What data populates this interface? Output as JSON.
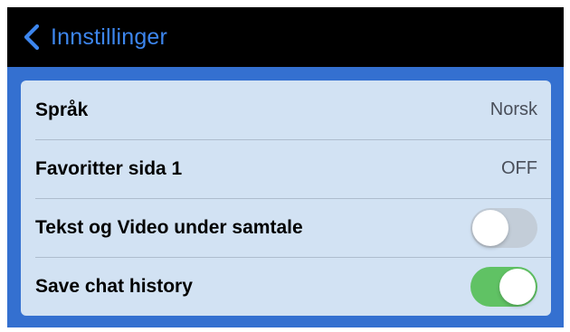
{
  "navbar": {
    "back_label": "Innstillinger",
    "back_icon": "chevron-left-icon",
    "background_color": "#000000",
    "accent_color": "#3d86ee"
  },
  "settings": {
    "rows": [
      {
        "label": "Språk",
        "value": "Norsk"
      },
      {
        "label": "Favoritter sida 1",
        "value": "OFF"
      },
      {
        "label": "Tekst og Video under samtale",
        "toggle": false
      },
      {
        "label": "Save chat history",
        "toggle": true
      }
    ]
  },
  "colors": {
    "page_background": "#3470d0",
    "card_background": "#d2e2f3",
    "toggle_on": "#60c264",
    "toggle_off": "#c3cdd8"
  }
}
